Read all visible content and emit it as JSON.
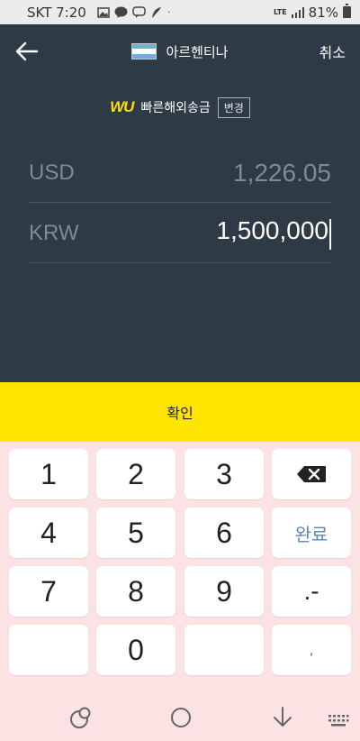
{
  "status_bar": {
    "carrier_time": "SKT 7:20",
    "dot": "·",
    "network": "LTE",
    "battery": "81%"
  },
  "header": {
    "country": "아르헨티나",
    "cancel_label": "취소"
  },
  "brand": {
    "logo_text": "WU",
    "name": "빠른해외송금",
    "change_label": "변경"
  },
  "currencies": [
    {
      "code": "USD",
      "value": "1,226.05"
    },
    {
      "code": "KRW",
      "value": "1,500,000"
    }
  ],
  "confirm_label": "확인",
  "keypad": {
    "keys": [
      "1",
      "2",
      "3",
      "4",
      "5",
      "6",
      "7",
      "8",
      "9",
      "0"
    ],
    "done_label": "완료",
    "decimal_label": ".-",
    "comma_label": ","
  },
  "colors": {
    "header_bg": "#2f3a47",
    "confirm_bg": "#ffe400",
    "keypad_bg": "#fbe3e3",
    "done_text": "#5c86b8"
  }
}
